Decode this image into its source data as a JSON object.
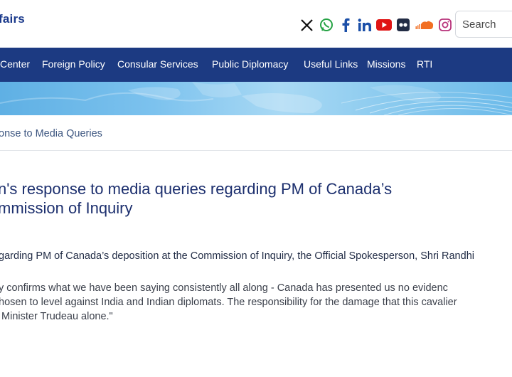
{
  "header": {
    "logo_text": "fairs",
    "social": [
      "x-icon",
      "whatsapp-icon",
      "facebook-icon",
      "linkedin-icon",
      "youtube-icon",
      "flickr-icon",
      "soundcloud-icon",
      "instagram-icon"
    ],
    "search_placeholder": "Search"
  },
  "nav": {
    "items": [
      "Center",
      "Foreign Policy",
      "Consular Services",
      "Public Diplomacy",
      "Useful Links",
      "Missions",
      "RTI"
    ]
  },
  "breadcrumb": {
    "current": "onse to Media Queries"
  },
  "article": {
    "title_line1": "n's response to media queries regarding PM of Canada’s",
    "title_line2": "mmission of Inquiry",
    "lead": "garding PM of Canada’s deposition at the Commission of Inquiry, the Official Spokesperson, Shri Randhi",
    "quote_line1": "y confirms what we have been saying consistently all along - Canada has presented us no evidenc",
    "quote_line2": "hosen to level against India and Indian diplomats. The responsibility for the damage that this cavalier",
    "quote_line3": " Minister Trudeau alone.\""
  },
  "colors": {
    "nav_bg": "#1c3a82",
    "title": "#1c2f6e",
    "banner": "#7cc2ee"
  }
}
